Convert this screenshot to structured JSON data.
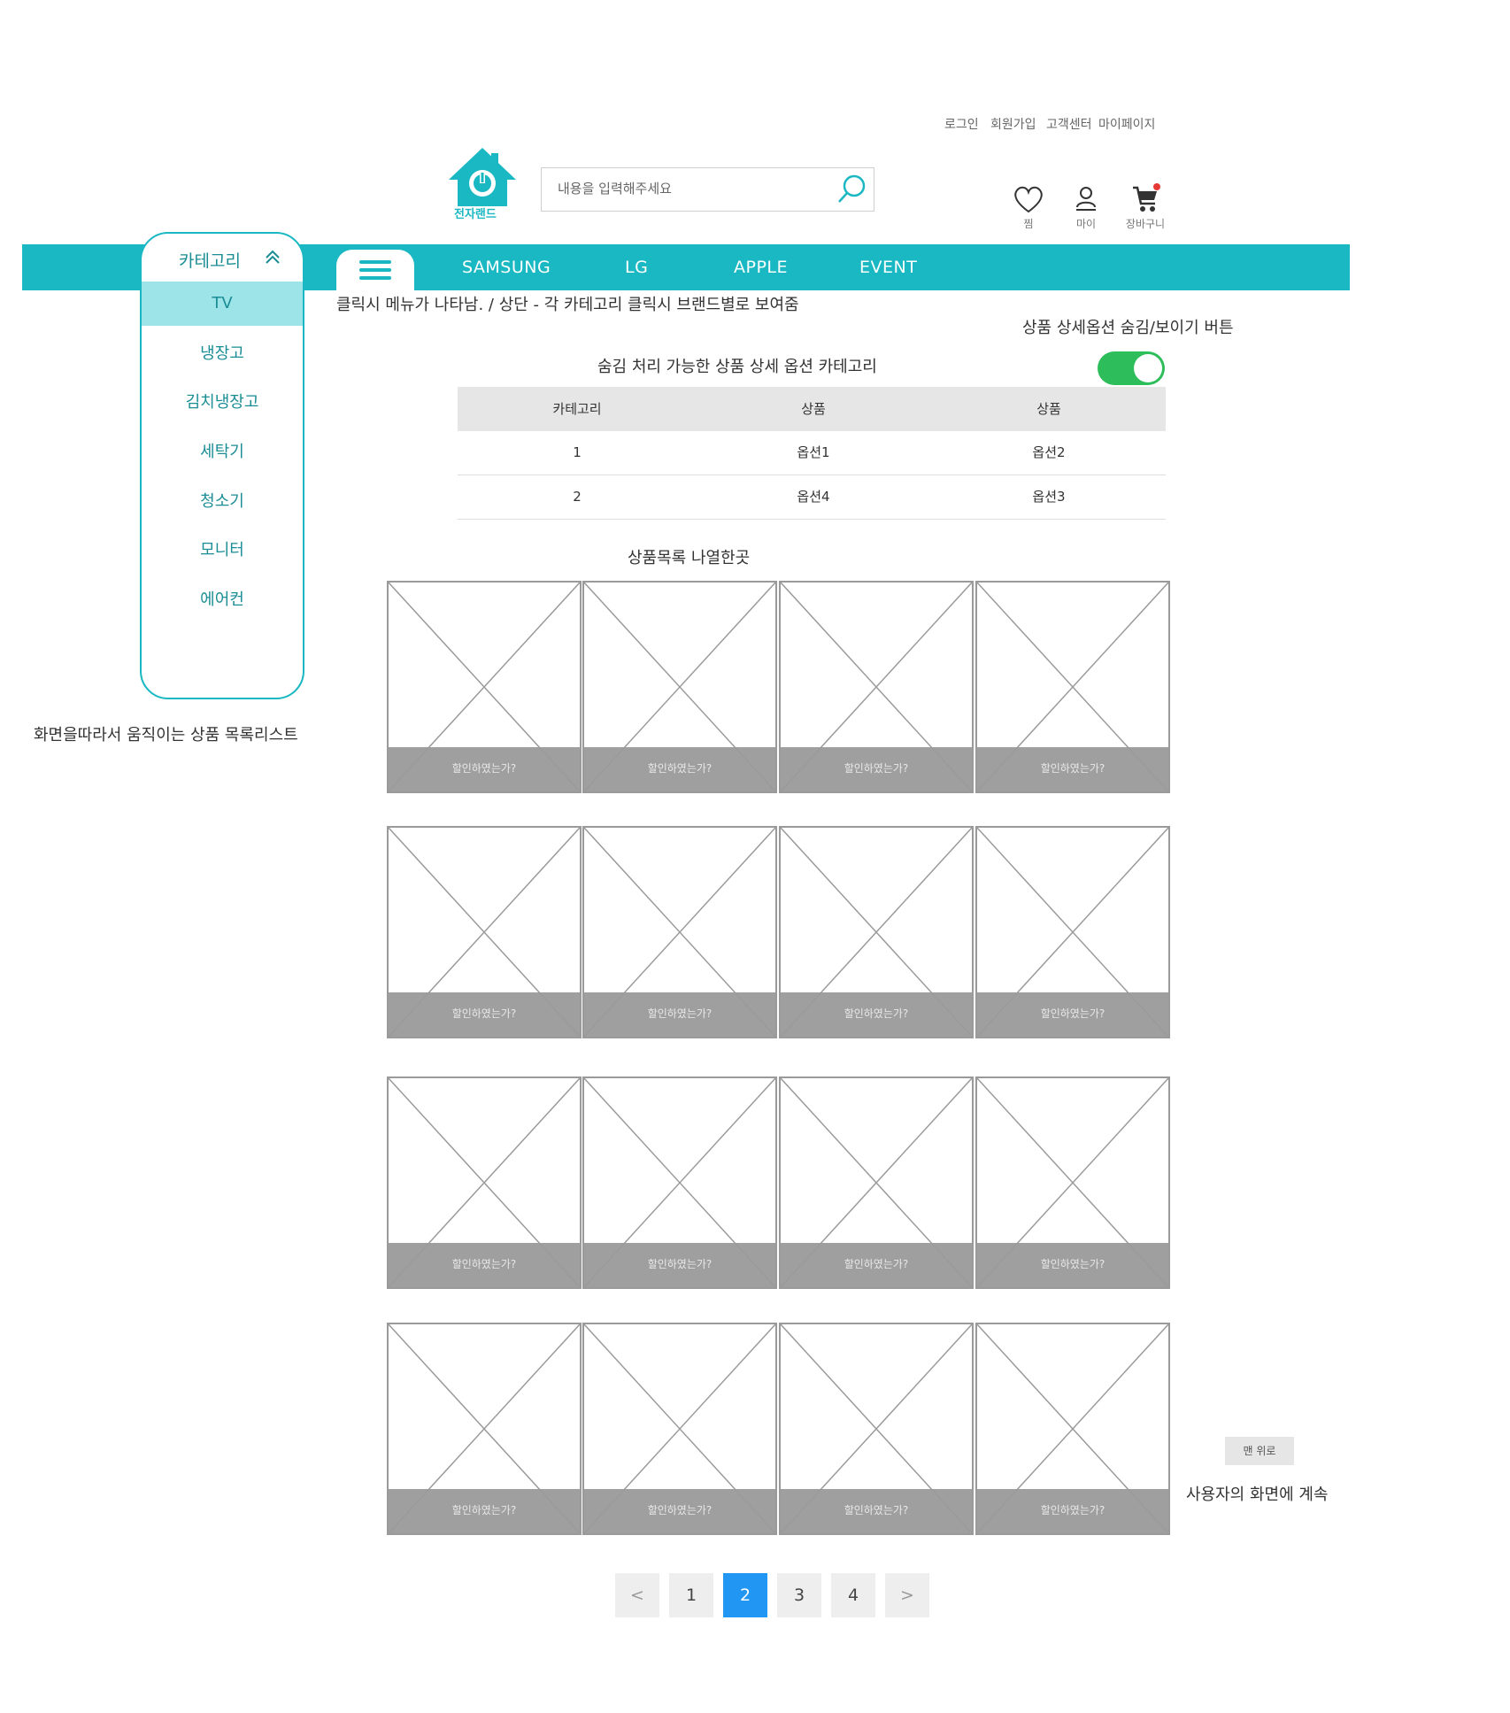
{
  "top_links": [
    "로그인",
    "회원가입",
    "고객센터",
    "마이페이지"
  ],
  "logo": {
    "text": "전자랜드"
  },
  "search": {
    "placeholder": "내용을 입력해주세요"
  },
  "util_icons": [
    {
      "icon": "heart-icon",
      "label": "찜"
    },
    {
      "icon": "user-icon",
      "label": "마이"
    },
    {
      "icon": "cart-icon",
      "label": "장바구니"
    }
  ],
  "nav": {
    "links": [
      "SAMSUNG",
      "LG",
      "APPLE",
      "EVENT"
    ],
    "accent": "#1ab8c3"
  },
  "category": {
    "title": "카테고리",
    "items": [
      "TV",
      "냉장고",
      "김치냉장고",
      "세탁기",
      "청소기",
      "모니터",
      "에어컨"
    ],
    "active": "TV"
  },
  "notes": {
    "menu_note": "클릭시 메뉴가 나타남. / 상단 - 각 카테고리 클릭시 브랜드별로 보여줌",
    "toggle_note": "상품 상세옵션 숨김/보이기 버튼",
    "option_title": "숨김 처리 가능한 상품 상세 옵션 카테고리",
    "sidebar_note": "화면을따라서 움직이는 상품 목록리스트",
    "list_title": "상품목록 나열한곳",
    "continue_note": "사용자의 화면에 계속"
  },
  "option_table": {
    "headers": [
      "카테고리",
      "상품",
      "상품"
    ],
    "rows": [
      [
        "1",
        "옵션1",
        "옵션2"
      ],
      [
        "2",
        "옵션4",
        "옵션3"
      ]
    ]
  },
  "toggle": {
    "on": true,
    "color": "#2ebd5b"
  },
  "product_caption": "할인하였는가?",
  "product_grid": {
    "rows": 4,
    "cols": 4
  },
  "pagination": {
    "prev": "<",
    "pages": [
      "1",
      "2",
      "3",
      "4"
    ],
    "active": "2",
    "next": ">"
  },
  "top_button": "맨 위로"
}
